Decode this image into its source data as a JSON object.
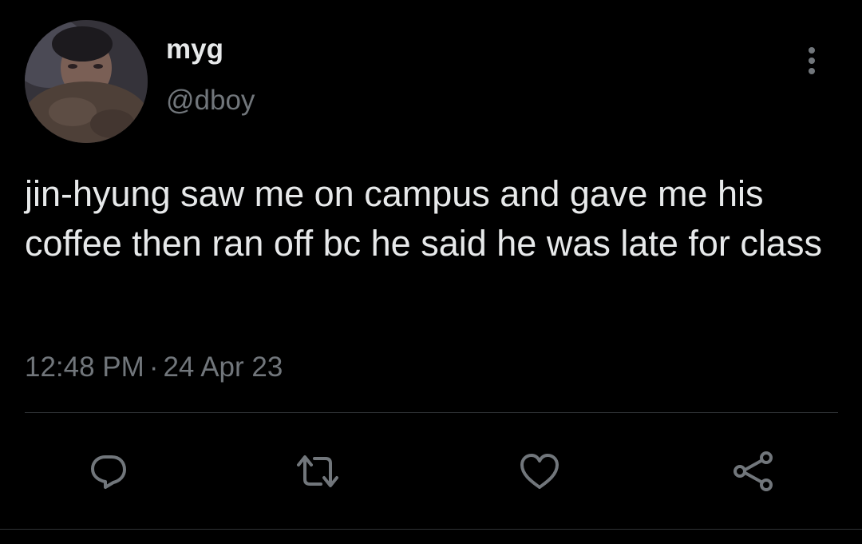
{
  "tweet": {
    "author": {
      "display_name": "myg",
      "handle": "@dboy",
      "avatar": "user-photo"
    },
    "text": "jin-hyung saw me on campus and gave me his coffee then ran off bc he said he was late for class",
    "time": "12:48 PM",
    "separator": "·",
    "date": "24 Apr 23"
  },
  "actions": [
    {
      "name": "reply",
      "icon": "speech-bubble-icon"
    },
    {
      "name": "retweet",
      "icon": "retweet-arrows-icon"
    },
    {
      "name": "like",
      "icon": "heart-icon"
    },
    {
      "name": "share",
      "icon": "share-nodes-icon"
    }
  ],
  "menu": {
    "icon": "more-vertical-icon"
  },
  "theme": {
    "background": "#000000",
    "text": "#e7e9ea",
    "secondary_text": "#71767b",
    "icon": "#71767b",
    "divider": "#2f3336"
  }
}
